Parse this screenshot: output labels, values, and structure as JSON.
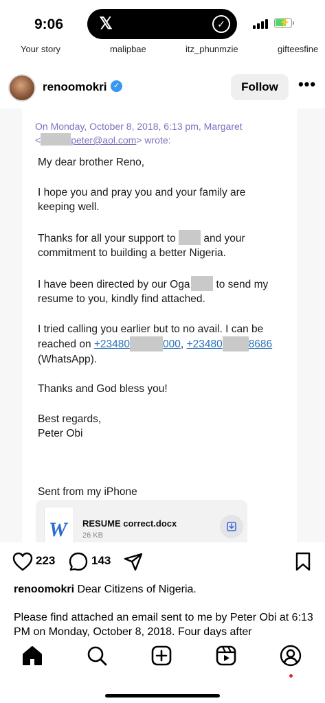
{
  "status_bar": {
    "time": "9:06",
    "island_app_glyph": "𝕏"
  },
  "stories": [
    {
      "label": "Your story"
    },
    {
      "label": "malipbae"
    },
    {
      "label": "itz_phunmzie"
    },
    {
      "label": "gifteesfine"
    }
  ],
  "post": {
    "username": "renoomokri",
    "verified": true,
    "follow_label": "Follow",
    "more_label": "•••"
  },
  "email": {
    "quote_line1": "On Monday, October 8, 2018, 6:13 pm, Margaret",
    "quote_line2_prefix": "<",
    "quote_line2_email": "peter@aol.com",
    "quote_line2_suffix": "> wrote:",
    "greeting": "My dear brother Reno,",
    "para1": "I hope you and pray you and your family are keeping well.",
    "para2_a": "Thanks for all your support to",
    "para2_b": "and your commitment to building a better Nigeria.",
    "para3_a": "I have been directed by our Oga",
    "para3_b": "to send my resume to you, kindly find attached.",
    "para4_a": "I tried calling you earlier but to no avail. I can be reached on",
    "phone1_a": "+23480",
    "phone1_b": "000",
    "phone_sep": ",",
    "phone2_a": "+23480",
    "phone2_b": "8686",
    "para4_b": "(WhatsApp).",
    "para5": "Thanks and God bless you!",
    "closing": "Best regards,",
    "signature": "Peter Obi",
    "sent_from": "Sent from my iPhone",
    "attachment_name": "RESUME correct.docx",
    "attachment_size": "26 KB",
    "attachment_icon_letter": "W"
  },
  "actions": {
    "likes": "223",
    "comments": "143"
  },
  "caption": {
    "username": "renoomokri",
    "line1": "Dear Citizens of Nigeria.",
    "body": "Please find attached an email sent to me by Peter Obi at 6:13 PM on Monday, October 8, 2018. Four days after"
  },
  "colors": {
    "verified_blue": "#3897f0",
    "link_blue": "#2a73b8",
    "quote_purple": "#7d6fbf",
    "notification_red": "#e4223a"
  }
}
